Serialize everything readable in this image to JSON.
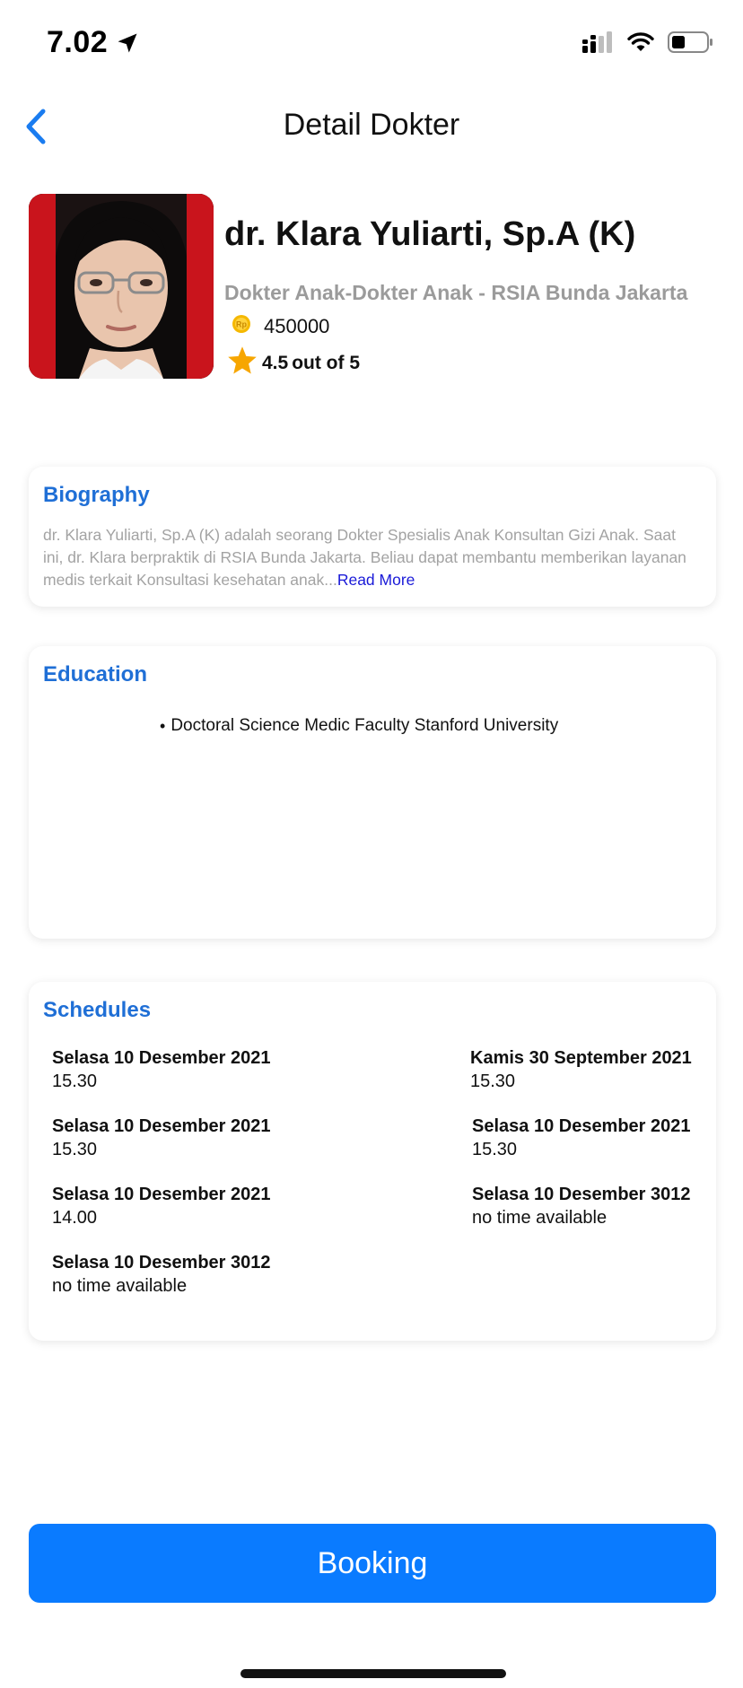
{
  "status_bar": {
    "time": "7.02"
  },
  "nav": {
    "title": "Detail Dokter"
  },
  "doctor": {
    "name": "dr. Klara Yuliarti, Sp.A (K)",
    "specialty": "Dokter Anak-Dokter Anak - RSIA Bunda Jakarta",
    "price": "450000",
    "rating_value": "4.5",
    "rating_suffix": "out of 5"
  },
  "biography": {
    "title": "Biography",
    "text": "dr. Klara Yuliarti, Sp.A (K) adalah seorang Dokter Spesialis Anak Konsultan Gizi Anak. Saat ini, dr. Klara berpraktik di RSIA Bunda Jakarta. Beliau dapat membantu memberikan layanan medis terkait Konsultasi kesehatan anak...",
    "read_more": "Read More"
  },
  "education": {
    "title": "Education",
    "items": [
      "Doctoral Science Medic Faculty Stanford University"
    ]
  },
  "schedules": {
    "title": "Schedules",
    "left": [
      {
        "date": "Selasa 10 Desember 2021",
        "time": "15.30"
      },
      {
        "date": "Selasa 10 Desember 2021",
        "time": "15.30"
      },
      {
        "date": "Selasa 10 Desember 2021",
        "time": "14.00"
      },
      {
        "date": "Selasa 10 Desember 3012",
        "time": "no time available"
      }
    ],
    "right": [
      {
        "date": "Kamis 30 September 2021",
        "time": "15.30"
      },
      {
        "date": "Selasa 10 Desember 2021",
        "time": "15.30"
      },
      {
        "date": "Selasa 10 Desember 3012",
        "time": "no time available"
      }
    ]
  },
  "booking": {
    "label": "Booking"
  },
  "colors": {
    "accent": "#0a7bff",
    "section_title": "#1f6fd6",
    "star": "#f7a600",
    "coin": "#f5b800"
  }
}
